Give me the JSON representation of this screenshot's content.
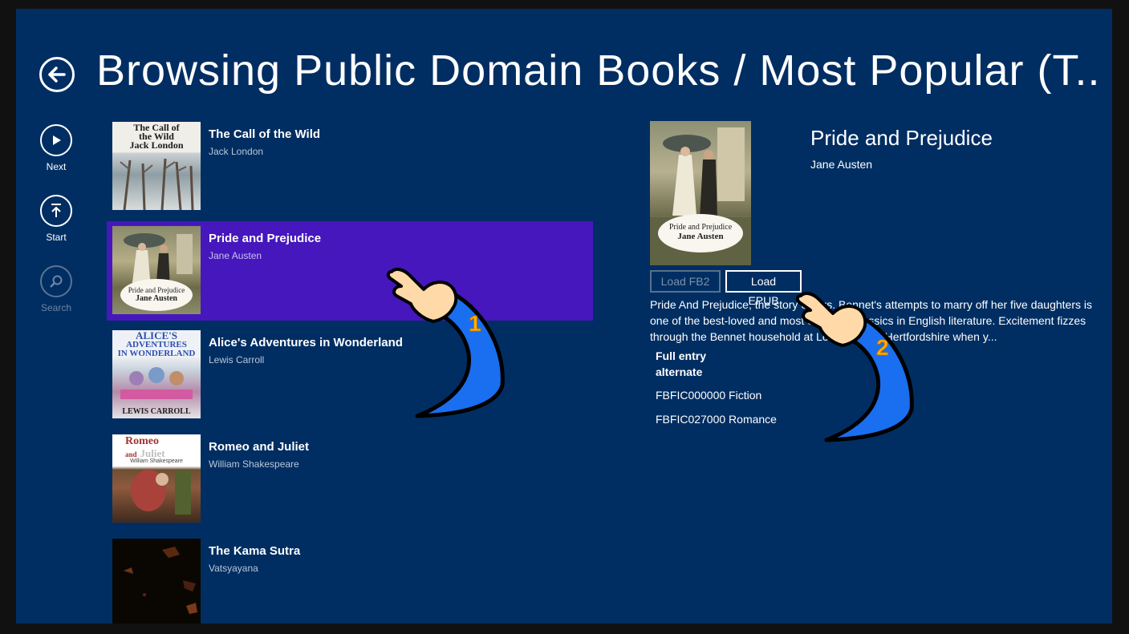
{
  "header": {
    "title": "Browsing Public Domain Books / Most Popular (T..."
  },
  "side_commands": [
    {
      "label": "Next",
      "icon": "play-icon",
      "enabled": true
    },
    {
      "label": "Start",
      "icon": "upload-icon",
      "enabled": true
    },
    {
      "label": "Search",
      "icon": "search-icon",
      "enabled": false
    }
  ],
  "books": [
    {
      "title": "The Call of the Wild",
      "author": "Jack London",
      "cover_text": [
        "The Call of",
        "the Wild",
        "Jack London"
      ],
      "selected": false
    },
    {
      "title": "Pride and Prejudice",
      "author": "Jane Austen",
      "cover_text": [
        "Pride and Prejudice",
        "Jane Austen"
      ],
      "selected": true
    },
    {
      "title": "Alice's Adventures in Wonderland",
      "author": "Lewis Carroll",
      "cover_text": [
        "ALICE'S",
        "ADVENTURES",
        "IN WONDERLAND",
        "LEWIS CARROLL"
      ],
      "selected": false
    },
    {
      "title": "Romeo and Juliet",
      "author": "William Shakespeare",
      "cover_text": [
        "Romeo",
        "and",
        "Juliet",
        "William Shakespeare"
      ],
      "selected": false
    },
    {
      "title": "The Kama Sutra",
      "author": "Vatsyayana",
      "cover_text": [],
      "selected": false
    }
  ],
  "detail": {
    "title": "Pride and Prejudice",
    "author": "Jane Austen",
    "cover_text": [
      "Pride and Prejudice",
      "Jane Austen"
    ],
    "load_fb2_label": "Load FB2",
    "load_epub_label": "Load EPUB",
    "description": "Pride And Prejudice, the story of Mrs. Bennet's attempts to marry off her five daughters is one of the best-loved and most enduring classics in English literature. Excitement fizzes through the Bennet household at Longbourn in Hertfordshire when y...",
    "entry_link_line1": "Full entry",
    "entry_link_line2": "alternate",
    "categories": [
      "FBFIC000000 Fiction",
      "FBFIC027000 Romance"
    ]
  },
  "annotations": [
    "1",
    "2"
  ],
  "colors": {
    "background": "#002e62",
    "selected": "#4517bd",
    "hand_sleeve": "#1a6ef0"
  }
}
